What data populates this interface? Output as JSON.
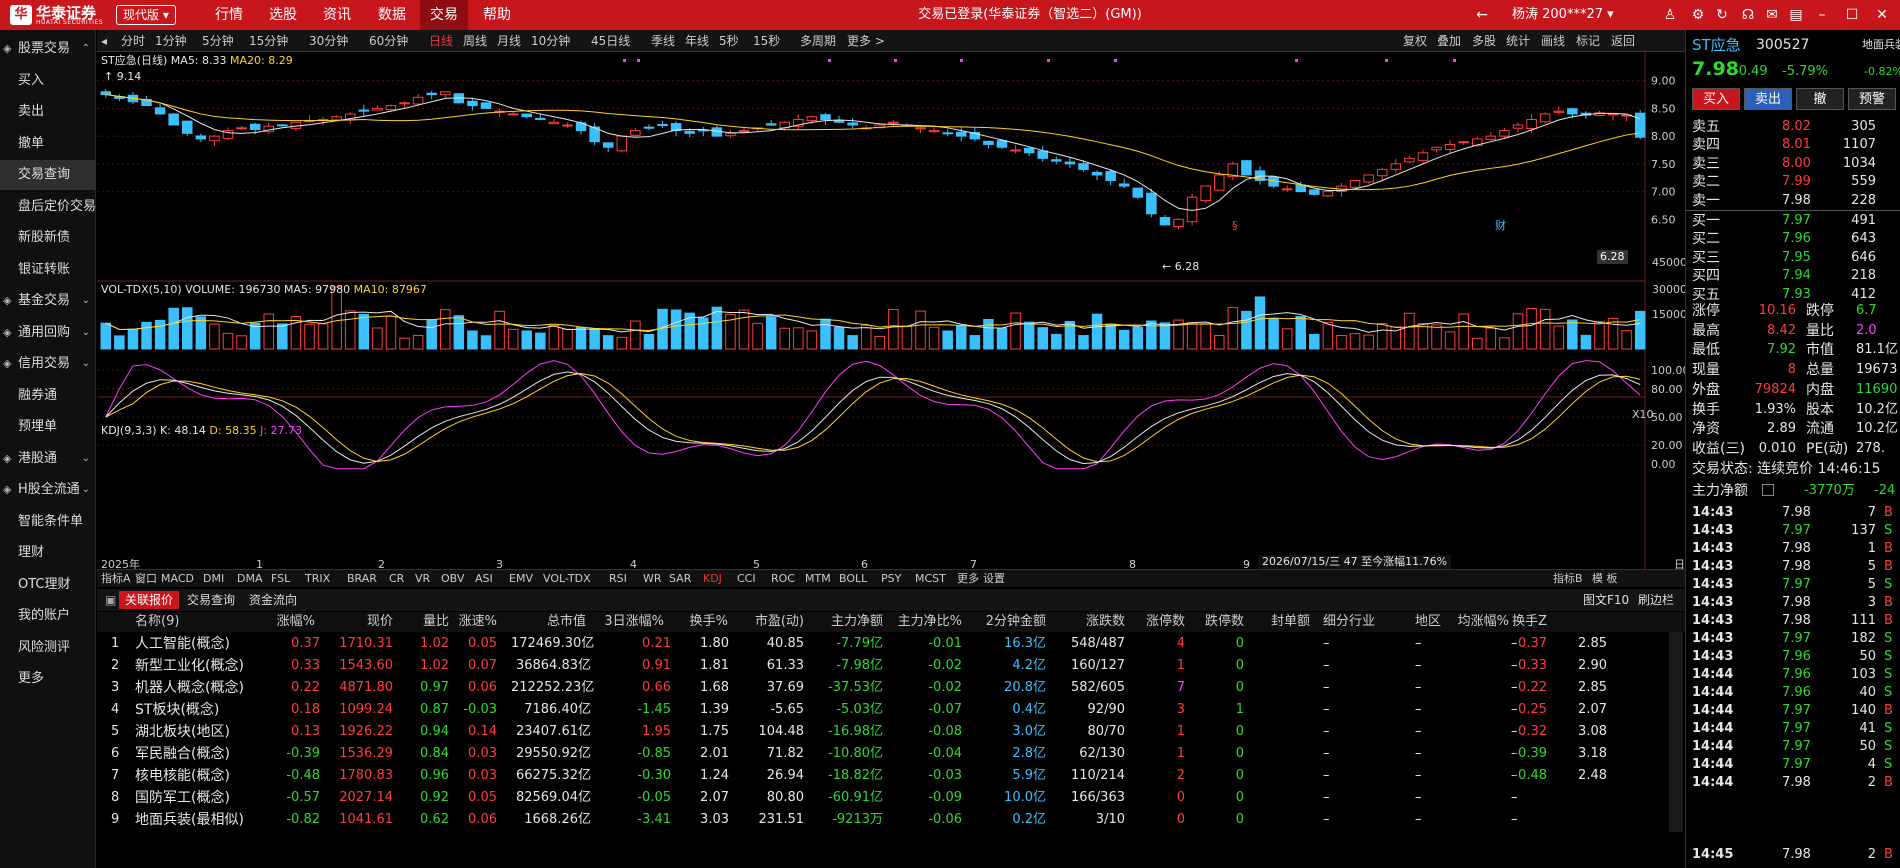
{
  "topbar": {
    "logo_cn": "华泰证券",
    "logo_en": "HUATAI SECURITIES",
    "logo_mark": "华",
    "version": "现代版",
    "menus": [
      "行情",
      "选股",
      "资讯",
      "数据",
      "交易",
      "帮助"
    ],
    "active_menu": "交易",
    "window_title": "交易已登录(华泰证券（智选二）(GM))",
    "user": "杨涛 200***27"
  },
  "sidebar": [
    {
      "label": "股票交易",
      "icon": "stock-trade",
      "arrow": "^"
    },
    {
      "label": "买入"
    },
    {
      "label": "卖出"
    },
    {
      "label": "撤单"
    },
    {
      "label": "交易查询",
      "selected": true
    },
    {
      "label": "盘后定价交易"
    },
    {
      "label": "新股新债"
    },
    {
      "label": "银证转账"
    },
    {
      "label": "基金交易",
      "arrow": "v"
    },
    {
      "label": "通用回购",
      "arrow": "v"
    },
    {
      "label": "信用交易",
      "arrow": "v"
    },
    {
      "label": "融券通"
    },
    {
      "label": "预埋单"
    },
    {
      "label": "港股通",
      "arrow": "v"
    },
    {
      "label": "H股全流通",
      "arrow": "v"
    },
    {
      "label": "智能条件单"
    },
    {
      "label": "理财"
    },
    {
      "label": "OTC理财"
    },
    {
      "label": "我的账户"
    },
    {
      "label": "风险测评"
    },
    {
      "label": "更多"
    }
  ],
  "periodbar": {
    "left": [
      "分时",
      "1分钟",
      "5分钟",
      "15分钟",
      "30分钟",
      "60分钟",
      "日线",
      "周线",
      "月线",
      "10分钟",
      "45日线",
      "季线",
      "年线",
      "5秒",
      "15秒",
      "多周期",
      "更多 >"
    ],
    "active": "日线",
    "right": [
      "复权",
      "叠加",
      "多股",
      "统计",
      "画线",
      "标记",
      "返回"
    ]
  },
  "chart_data": {
    "type": "candlestick",
    "title": "ST应急(日线)",
    "ma": {
      "MA5": "8.33",
      "MA20": "8.29"
    },
    "price_axis": [
      "9.00",
      "8.50",
      "8.00",
      "7.50",
      "7.00",
      "6.50"
    ],
    "high_label": "9.14",
    "low_label": "6.28",
    "last_price_label": "6.28",
    "volume": {
      "label": "VOL-TDX(5,10)",
      "VOLUME": "196730",
      "MA5": "97980",
      "MA10": "87967",
      "axis": [
        "45000",
        "30000",
        "15000"
      ],
      "unit": "X10"
    },
    "kdj": {
      "label": "KDJ(9,3,3)",
      "K": "48.14",
      "D": "58.35",
      "J": "27.73",
      "axis": [
        "100.00",
        "80.00",
        "50.00",
        "20.00",
        "0.00"
      ]
    },
    "x_labels": [
      "2025年",
      "1",
      "2",
      "3",
      "4",
      "5",
      "6",
      "7",
      "8",
      "9"
    ],
    "cursor_info": "2026/07/15/三 47 至今涨幅11.76%",
    "close": [
      8.75,
      8.68,
      8.62,
      8.55,
      8.4,
      8.2,
      8.05,
      7.95,
      8.0,
      8.1,
      8.15,
      8.12,
      8.18,
      8.2,
      8.25,
      8.28,
      8.3,
      8.35,
      8.4,
      8.45,
      8.5,
      8.55,
      8.6,
      8.7,
      8.75,
      8.8,
      8.6,
      8.55,
      8.5,
      8.45,
      8.4,
      8.35,
      8.3,
      8.25,
      8.2,
      8.1,
      7.9,
      7.8,
      8.0,
      8.1,
      8.15,
      8.2,
      8.1,
      8.05,
      8.1,
      8.0,
      8.05,
      8.1,
      8.15,
      8.2,
      8.25,
      8.3,
      8.35,
      8.3,
      8.25,
      8.2,
      8.15,
      8.2,
      8.25,
      8.2,
      8.15,
      8.1,
      8.05,
      8.0,
      7.95,
      7.85,
      7.8,
      7.75,
      7.7,
      7.6,
      7.55,
      7.5,
      7.4,
      7.3,
      7.2,
      7.1,
      6.9,
      6.6,
      6.4,
      6.5,
      6.9,
      7.1,
      7.3,
      7.5,
      7.3,
      7.2,
      7.1,
      7.05,
      7.0,
      6.95,
      7.0,
      7.1,
      7.2,
      7.3,
      7.4,
      7.5,
      7.6,
      7.7,
      7.8,
      7.85,
      7.9,
      7.95,
      8.0,
      8.1,
      8.2,
      8.3,
      8.4,
      8.45,
      8.4,
      8.38,
      8.42,
      8.4,
      8.38,
      7.98
    ]
  },
  "indicator_tabs": [
    "指标A",
    "窗口",
    "MACD",
    "DMI",
    "DMA",
    "FSL",
    "TRIX",
    "BRAR",
    "CR",
    "VR",
    "OBV",
    "ASI",
    "EMV",
    "VOL-TDX",
    "RSI",
    "WR",
    "SAR",
    "KDJ",
    "CCI",
    "ROC",
    "MTM",
    "BOLL",
    "PSY",
    "MCST",
    "更多",
    "设置"
  ],
  "indicator_right": [
    "指标B",
    "模 板"
  ],
  "active_indicator": "KDJ",
  "table_tabs": [
    "关联报价",
    "交易查询",
    "资金流向"
  ],
  "table_tabs_right": [
    "图文F10",
    "刷边栏"
  ],
  "table": {
    "headers": [
      "名称(9)",
      "涨幅%",
      "现价",
      "量比",
      "涨速%",
      "总市值",
      "3日涨幅%",
      "换手%",
      "市盈(动)",
      "主力净额",
      "主力净比%",
      "2分钟金额",
      "涨跌数",
      "涨停数",
      "跌停数",
      "封单额",
      "细分行业",
      "地区",
      "均涨幅%",
      "换手Z"
    ],
    "rows": [
      [
        "1",
        "人工智能(概念)",
        "0.37",
        "1710.31",
        "1.02",
        "0.05",
        "172469.30亿",
        "0.21",
        "1.80",
        "40.85",
        "-7.79亿",
        "-0.01",
        "16.3亿",
        "548/487",
        "4",
        "0",
        "–",
        "–",
        "–",
        "0.37",
        "2.85"
      ],
      [
        "2",
        "新型工业化(概念)",
        "0.33",
        "1543.60",
        "1.02",
        "0.07",
        "36864.83亿",
        "0.91",
        "1.81",
        "61.33",
        "-7.98亿",
        "-0.02",
        "4.2亿",
        "160/127",
        "1",
        "0",
        "–",
        "–",
        "–",
        "0.33",
        "2.90"
      ],
      [
        "3",
        "机器人概念(概念)",
        "0.22",
        "4871.80",
        "0.97",
        "0.06",
        "212252.23亿",
        "0.66",
        "1.68",
        "37.69",
        "-37.53亿",
        "-0.02",
        "20.8亿",
        "582/605",
        "7",
        "0",
        "–",
        "–",
        "–",
        "0.22",
        "2.85"
      ],
      [
        "4",
        "ST板块(概念)",
        "0.18",
        "1099.24",
        "0.87",
        "-0.03",
        "7186.40亿",
        "-1.45",
        "1.39",
        "-5.65",
        "-5.03亿",
        "-0.07",
        "0.4亿",
        "92/90",
        "3",
        "1",
        "–",
        "–",
        "–",
        "0.25",
        "2.07"
      ],
      [
        "5",
        "湖北板块(地区)",
        "0.13",
        "1926.22",
        "0.94",
        "0.14",
        "23407.61亿",
        "1.95",
        "1.75",
        "104.48",
        "-16.98亿",
        "-0.08",
        "3.0亿",
        "80/70",
        "1",
        "0",
        "–",
        "–",
        "–",
        "0.32",
        "3.08"
      ],
      [
        "6",
        "军民融合(概念)",
        "-0.39",
        "1536.29",
        "0.84",
        "0.03",
        "29550.92亿",
        "-0.85",
        "2.01",
        "71.82",
        "-10.80亿",
        "-0.04",
        "2.8亿",
        "62/130",
        "1",
        "0",
        "–",
        "–",
        "–",
        "-0.39",
        "3.18"
      ],
      [
        "7",
        "核电核能(概念)",
        "-0.48",
        "1780.83",
        "0.96",
        "0.03",
        "66275.32亿",
        "-0.30",
        "1.24",
        "26.94",
        "-18.82亿",
        "-0.03",
        "5.9亿",
        "110/214",
        "2",
        "0",
        "–",
        "–",
        "–",
        "-0.48",
        "2.48"
      ],
      [
        "8",
        "国防军工(概念)",
        "-0.57",
        "2027.14",
        "0.92",
        "0.05",
        "82569.04亿",
        "-0.05",
        "2.07",
        "80.80",
        "-60.91亿",
        "-0.09",
        "10.0亿",
        "166/363",
        "0",
        "0",
        "–",
        "–",
        "–",
        "",
        ""
      ],
      [
        "9",
        "地面兵装(最相似)",
        "-0.82",
        "1041.61",
        "0.62",
        "0.06",
        "1668.26亿",
        "-3.41",
        "3.03",
        "231.51",
        "-9213万",
        "-0.06",
        "0.2亿",
        "3/10",
        "0",
        "0",
        "–",
        "–",
        "–",
        "",
        ""
      ]
    ]
  },
  "right": {
    "stock_name": "ST应急",
    "stock_code": "300527",
    "sector": "地面兵装",
    "sector_change": "-0.82%",
    "price": "7.98",
    "change": "-0.49",
    "change_pct": "-5.79%",
    "buttons": [
      "买入",
      "卖出",
      "撤",
      "预警"
    ],
    "asks": [
      [
        "卖五",
        "8.02",
        "305"
      ],
      [
        "卖四",
        "8.01",
        "1107"
      ],
      [
        "卖三",
        "8.00",
        "1034"
      ],
      [
        "卖二",
        "7.99",
        "559"
      ],
      [
        "卖一",
        "7.98",
        "228"
      ]
    ],
    "bids": [
      [
        "买一",
        "7.97",
        "491"
      ],
      [
        "买二",
        "7.96",
        "643"
      ],
      [
        "买三",
        "7.95",
        "646"
      ],
      [
        "买四",
        "7.94",
        "218"
      ],
      [
        "买五",
        "7.93",
        "412"
      ]
    ],
    "stats": [
      [
        "涨停",
        "10.16",
        "跌停",
        "6.7"
      ],
      [
        "最高",
        "8.42",
        "量比",
        "2.0"
      ],
      [
        "最低",
        "7.92",
        "市值",
        "81.1亿"
      ],
      [
        "现量",
        "8",
        "总量",
        "19673"
      ],
      [
        "外盘",
        "79824",
        "内盘",
        "11690"
      ],
      [
        "换手",
        "1.93%",
        "股本",
        "10.2亿"
      ],
      [
        "净资",
        "2.89",
        "流通",
        "10.2亿"
      ],
      [
        "收益(三)",
        "0.010",
        "PE(动)",
        "278."
      ]
    ],
    "trade_status": "交易状态: 连续竞价 14:46:15",
    "main_flow_label": "主力净额",
    "main_flow_value": "-3770万",
    "main_flow_extra": "-24",
    "ticks": [
      [
        "14:43",
        "7.98",
        "7",
        "B"
      ],
      [
        "14:43",
        "7.97",
        "137",
        "S"
      ],
      [
        "14:43",
        "7.98",
        "1",
        "B"
      ],
      [
        "14:43",
        "7.98",
        "5",
        "B"
      ],
      [
        "14:43",
        "7.97",
        "5",
        "S"
      ],
      [
        "14:43",
        "7.98",
        "3",
        "B"
      ],
      [
        "14:43",
        "7.98",
        "111",
        "B"
      ],
      [
        "14:43",
        "7.97",
        "182",
        "S"
      ],
      [
        "14:43",
        "7.96",
        "50",
        "S"
      ],
      [
        "14:44",
        "7.96",
        "103",
        "S"
      ],
      [
        "14:44",
        "7.96",
        "40",
        "S"
      ],
      [
        "14:44",
        "7.97",
        "140",
        "B"
      ],
      [
        "14:44",
        "7.97",
        "41",
        "S"
      ],
      [
        "14:44",
        "7.97",
        "50",
        "S"
      ],
      [
        "14:44",
        "7.97",
        "4",
        "S"
      ],
      [
        "14:44",
        "7.98",
        "2",
        "B"
      ]
    ],
    "last_tick": [
      "14:45",
      "7.98",
      "2",
      "B"
    ]
  },
  "colors": {
    "up": "#ff3b3b",
    "down": "#2fd92f",
    "cyan": "#3ac0ff",
    "accent": "#c8161d",
    "yellow": "#ffd21f",
    "magenta": "#ff3bff"
  }
}
